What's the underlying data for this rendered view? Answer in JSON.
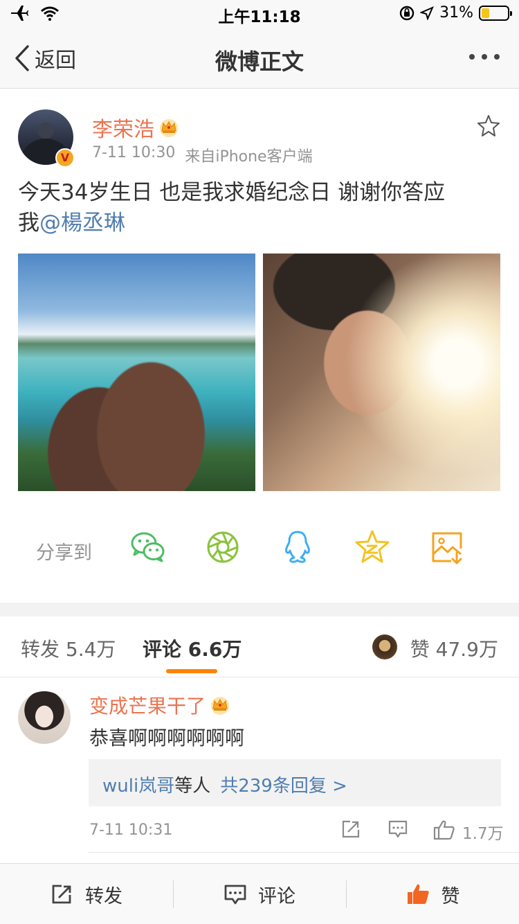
{
  "status_bar": {
    "time": "上午11:18",
    "battery_percent": "31%",
    "battery_level": 0.31,
    "icons": [
      "airplane-icon",
      "wifi-icon",
      "orientation-lock-icon",
      "location-icon",
      "battery-icon"
    ]
  },
  "nav": {
    "back_label": "返回",
    "title": "微博正文",
    "more_icon": "more-icon"
  },
  "post": {
    "author": "李荣浩",
    "time": "7-11 10:30",
    "source": "来自iPhone客户端",
    "text_line1": "今天34岁生日 也是我求婚纪念日 谢谢你答应",
    "text_line2_prefix": "我",
    "mention": "@楊丞琳",
    "share_label": "分享到",
    "share_targets": [
      "wechat-icon",
      "moments-icon",
      "qq-icon",
      "qzone-icon",
      "save-image-icon"
    ]
  },
  "tabs": {
    "repost": "转发 5.4万",
    "comment": "评论 6.6万",
    "like": "赞 47.9万"
  },
  "comment": {
    "author": "变成芒果干了",
    "text": "恭喜啊啊啊啊啊啊",
    "reply_users": "wuli岚哥",
    "reply_mid": "等人",
    "reply_count": "共239条回复 >",
    "time": "7-11 10:31",
    "likes": "1.7万"
  },
  "bottom_bar": {
    "repost": "转发",
    "comment": "评论",
    "like": "赞"
  },
  "colors": {
    "accent": "#ff8200",
    "name": "#eb7350",
    "link": "#507daf",
    "muted": "#939393"
  }
}
